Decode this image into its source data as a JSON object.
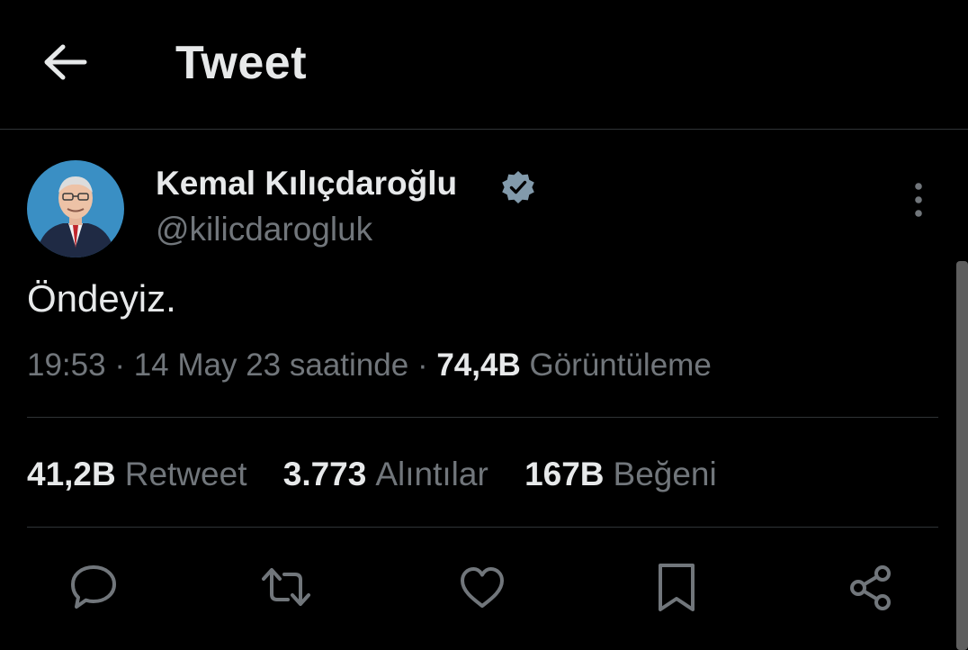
{
  "header": {
    "title": "Tweet"
  },
  "tweet": {
    "author_name": "Kemal Kılıçdaroğlu",
    "handle": "@kilicdarogluk",
    "text": "Öndeyiz.",
    "time": "19:53",
    "date": "14 May 23 saatinde",
    "views_count": "74,4B",
    "views_label": "Görüntüleme",
    "separator": "·"
  },
  "stats": {
    "retweets": {
      "count": "41,2B",
      "label": "Retweet"
    },
    "quotes": {
      "count": "3.773",
      "label": "Alıntılar"
    },
    "likes": {
      "count": "167B",
      "label": "Beğeni"
    }
  },
  "icons": {
    "back": "arrow-left-icon",
    "verified": "verified-badge-icon",
    "more": "more-vertical-icon",
    "reply": "reply-icon",
    "retweet": "retweet-icon",
    "like": "heart-icon",
    "bookmark": "bookmark-icon",
    "share": "share-icon"
  },
  "colors": {
    "background": "#000000",
    "text_primary": "#e7e9ea",
    "text_secondary": "#71767b",
    "divider": "#2f3336",
    "verified": "#829aab"
  }
}
